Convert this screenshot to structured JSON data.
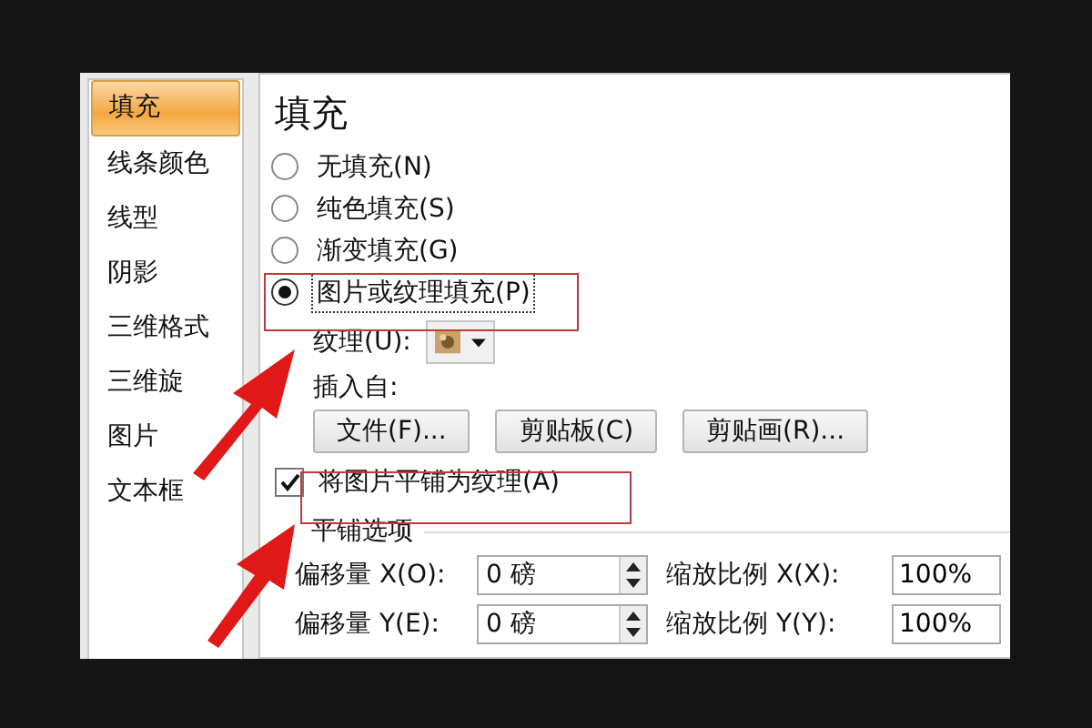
{
  "sidebar": {
    "items": [
      {
        "label": "填充",
        "selected": true
      },
      {
        "label": "线条颜色",
        "selected": false
      },
      {
        "label": "线型",
        "selected": false
      },
      {
        "label": "阴影",
        "selected": false
      },
      {
        "label": "三维格式",
        "selected": false
      },
      {
        "label": "三维旋",
        "selected": false
      },
      {
        "label": "图片",
        "selected": false
      },
      {
        "label": "文本框",
        "selected": false
      }
    ]
  },
  "panel": {
    "title": "填充",
    "fill_options": [
      {
        "label": "无填充(N)",
        "selected": false
      },
      {
        "label": "纯色填充(S)",
        "selected": false
      },
      {
        "label": "渐变填充(G)",
        "selected": false
      },
      {
        "label": "图片或纹理填充(P)",
        "selected": true
      }
    ],
    "texture": {
      "label": "纹理(U):"
    },
    "insert_from": {
      "label": "插入自:",
      "buttons": [
        "文件(F)...",
        "剪贴板(C)",
        "剪贴画(R)..."
      ]
    },
    "tile_checkbox": {
      "label": "将图片平铺为纹理(A)",
      "checked": true
    },
    "tiling": {
      "title": "平铺选项",
      "rows": [
        {
          "offset_label": "偏移量 X(O):",
          "offset_value": "0 磅",
          "scale_label": "缩放比例 X(X):",
          "scale_value": "100%"
        },
        {
          "offset_label": "偏移量 Y(E):",
          "offset_value": "0 磅",
          "scale_label": "缩放比例 Y(Y):",
          "scale_value": "100%"
        }
      ]
    }
  }
}
